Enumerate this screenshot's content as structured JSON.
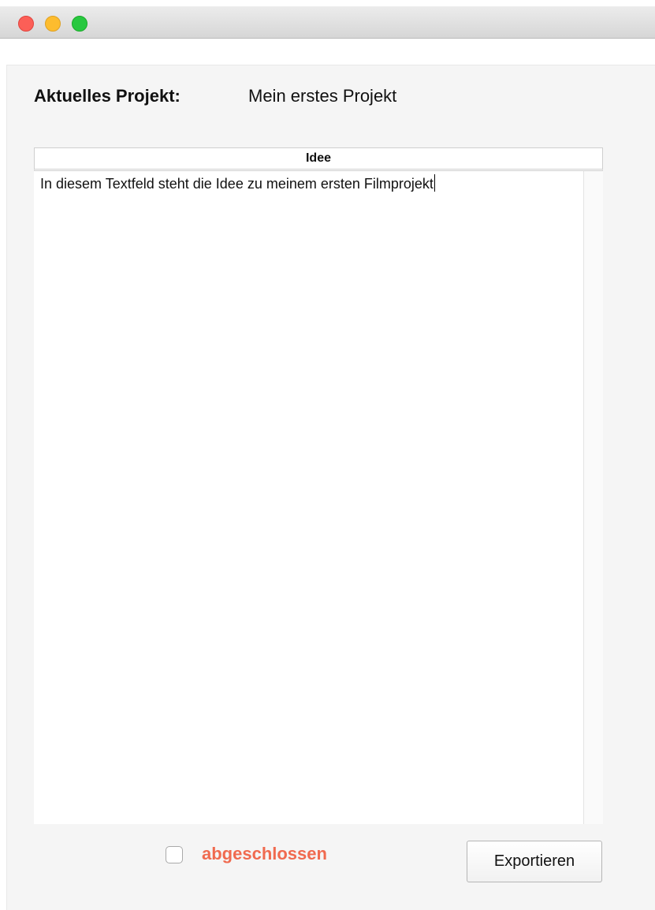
{
  "window": {
    "controls": [
      "close",
      "minimize",
      "maximize"
    ]
  },
  "project": {
    "label": "Aktuelles Projekt:",
    "name": "Mein erstes Projekt"
  },
  "table": {
    "header": "Idee",
    "content": "In diesem Textfeld steht die Idee zu meinem ersten Filmprojekt"
  },
  "footer": {
    "checkbox_label": "abgeschlossen",
    "checkbox_checked": false,
    "export_label": "Exportieren"
  },
  "colors": {
    "accent_label": "#f06a4f",
    "close": "#fc5f57",
    "minimize": "#fdbc2e",
    "maximize": "#28c840"
  }
}
